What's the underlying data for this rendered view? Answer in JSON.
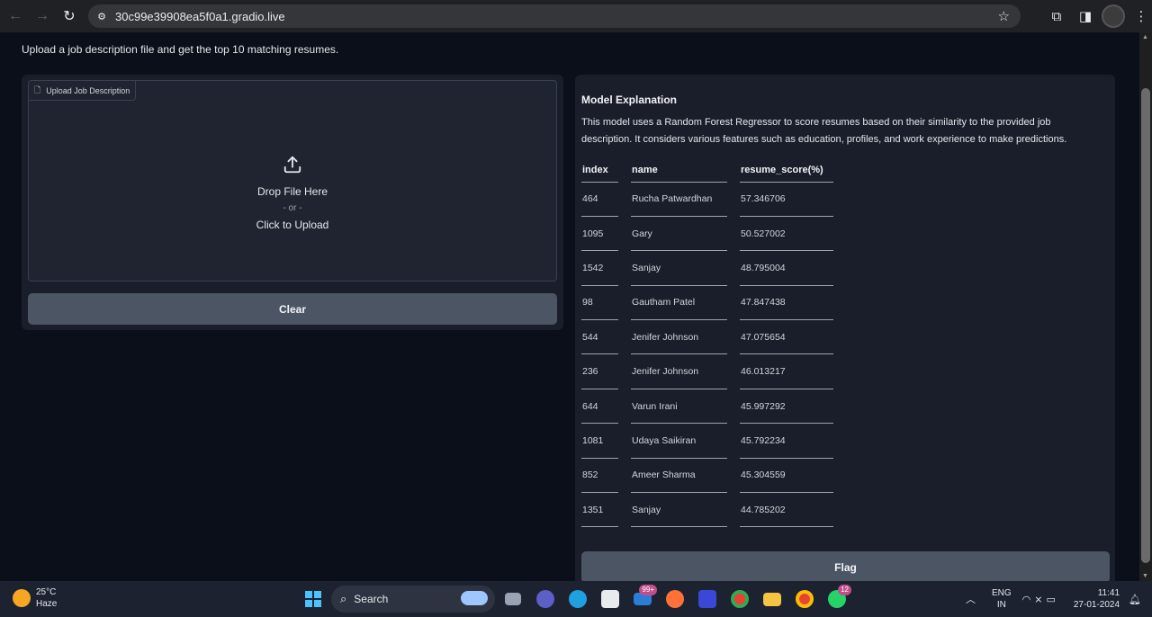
{
  "browser": {
    "url": "30c99e39908ea5f0a1.gradio.live",
    "back_icon": "←",
    "forward_icon": "→",
    "reload_icon": "↻",
    "star_icon": "☆"
  },
  "page": {
    "intro": "Upload a job description file and get the top 10 matching resumes.",
    "upload": {
      "label": "Upload Job Description",
      "drop_text": "Drop File Here",
      "or_text": "- or -",
      "click_text": "Click to Upload"
    },
    "clear_label": "Clear",
    "flag_label": "Flag",
    "explanation": {
      "title": "Model Explanation",
      "text": "This model uses a Random Forest Regressor to score resumes based on their similarity to the provided job description. It considers various features such as education, profiles, and work experience to make predictions."
    },
    "table": {
      "headers": [
        "index",
        "name",
        "resume_score(%)"
      ],
      "rows": [
        [
          "464",
          "Rucha Patwardhan",
          "57.346706"
        ],
        [
          "1095",
          "Gary",
          "50.527002"
        ],
        [
          "1542",
          "Sanjay",
          "48.795004"
        ],
        [
          "98",
          "Gautham Patel",
          "47.847438"
        ],
        [
          "544",
          "Jenifer Johnson",
          "47.075654"
        ],
        [
          "236",
          "Jenifer Johnson",
          "46.013217"
        ],
        [
          "644",
          "Varun Irani",
          "45.997292"
        ],
        [
          "1081",
          "Udaya Saikiran",
          "45.792234"
        ],
        [
          "852",
          "Ameer Sharma",
          "45.304559"
        ],
        [
          "1351",
          "Sanjay",
          "44.785202"
        ]
      ]
    }
  },
  "taskbar": {
    "weather_temp": "25°C",
    "weather_desc": "Haze",
    "search_label": "Search",
    "mail_badge": "99+",
    "whatsapp_badge": "12",
    "lang_top": "ENG",
    "lang_bottom": "IN",
    "time": "11:41",
    "date": "27-01-2024"
  }
}
